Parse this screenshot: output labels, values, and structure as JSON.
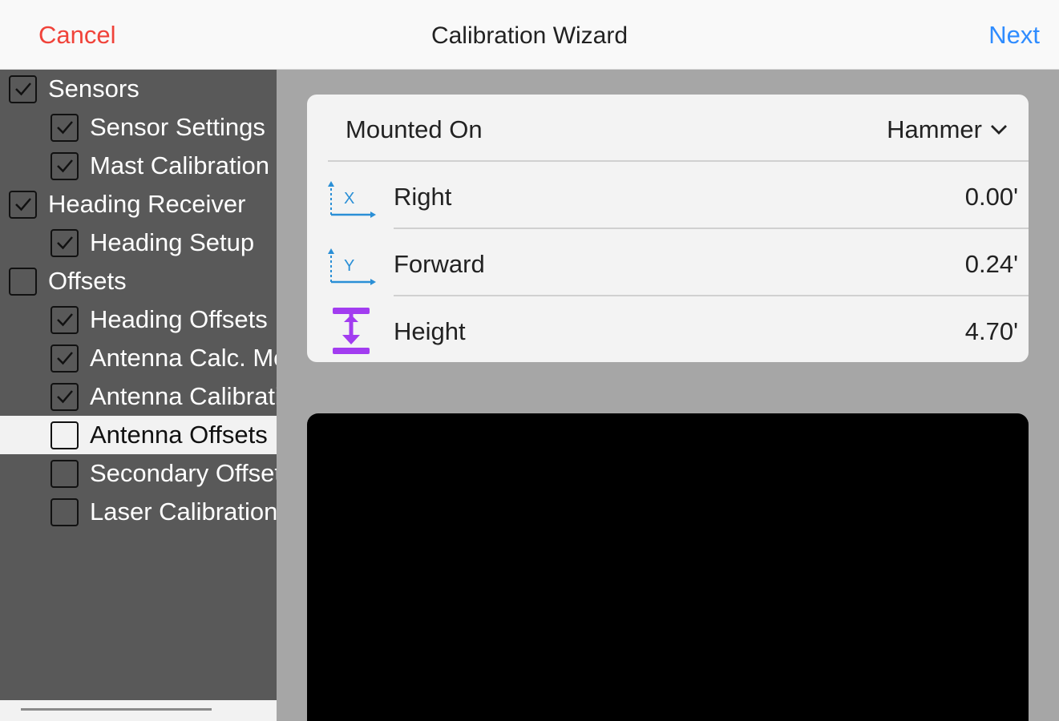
{
  "header": {
    "cancel_label": "Cancel",
    "title": "Calibration Wizard",
    "next_label": "Next"
  },
  "sidebar": {
    "items": [
      {
        "label": "Sensors",
        "checked": true,
        "level": 0
      },
      {
        "label": "Sensor Settings",
        "checked": true,
        "level": 1
      },
      {
        "label": "Mast Calibration",
        "checked": true,
        "level": 1
      },
      {
        "label": "Heading Receiver",
        "checked": true,
        "level": 0
      },
      {
        "label": "Heading Setup",
        "checked": true,
        "level": 1
      },
      {
        "label": "Offsets",
        "checked": false,
        "level": 0
      },
      {
        "label": "Heading Offsets",
        "checked": true,
        "level": 1
      },
      {
        "label": "Antenna Calc. Mode",
        "checked": true,
        "level": 1
      },
      {
        "label": "Antenna Calibration",
        "checked": true,
        "level": 1
      },
      {
        "label": "Antenna Offsets",
        "checked": false,
        "level": 1,
        "selected": true
      },
      {
        "label": "Secondary Offsets",
        "checked": false,
        "level": 1
      },
      {
        "label": "Laser Calibration",
        "checked": false,
        "level": 1
      }
    ]
  },
  "offsets": {
    "mounted_on_label": "Mounted On",
    "mounted_on_value": "Hammer",
    "rows": [
      {
        "label": "Right",
        "value": "0.00'",
        "axis": "X",
        "icon": "x-axis-icon"
      },
      {
        "label": "Forward",
        "value": "0.24'",
        "axis": "Y",
        "icon": "y-axis-icon"
      },
      {
        "label": "Height",
        "value": "4.70'",
        "icon": "height-icon"
      }
    ]
  },
  "colors": {
    "cancel": "#f0433a",
    "next": "#2f8cff",
    "axis_icon": "#2a8fd6",
    "height_icon": "#a23cf0",
    "sidebar_bg": "#595959",
    "content_bg": "#a6a6a6"
  }
}
